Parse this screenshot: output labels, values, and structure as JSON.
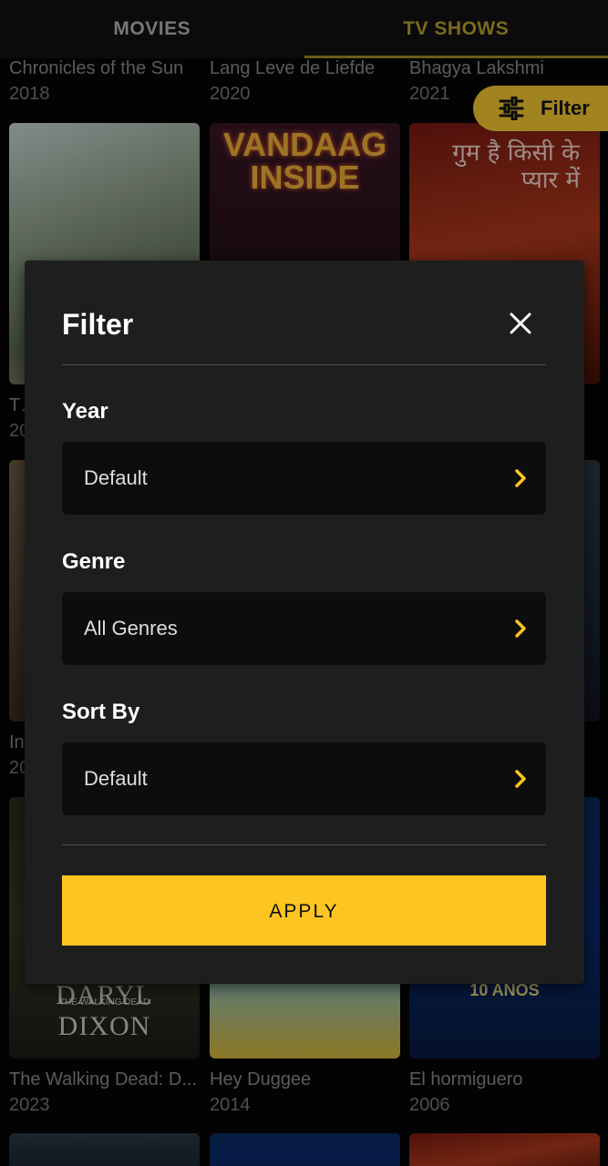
{
  "tabs": [
    {
      "label": "MOVIES"
    },
    {
      "label": "TV SHOWS"
    }
  ],
  "filter_button": {
    "label": "Filter",
    "icon": "sliders-icon"
  },
  "grid": {
    "top_row": [
      {
        "title": "Chronicles of the Sun",
        "year": "2018"
      },
      {
        "title": "Lang Leve de Liefde",
        "year": "2020"
      },
      {
        "title": "Bhagya Lakshmi",
        "year": "2021"
      }
    ],
    "row1_posters": {
      "poster2_text": "VANDAAG INSIDE",
      "poster3_text": "गुम है किसी के प्यार में"
    },
    "row1_captions": [
      {
        "title": "Th",
        "year": "20"
      }
    ],
    "row2_captions": [
      {
        "title": "In",
        "year": "20"
      }
    ],
    "row3_posters": {
      "poster1_small": "THE WALKING DEAD",
      "poster1_text": "DARYL DIXON",
      "poster3_text": "10 AÑOS"
    },
    "row3": [
      {
        "title": "The Walking Dead: D...",
        "year": "2023"
      },
      {
        "title": "Hey Duggee",
        "year": "2014"
      },
      {
        "title": "El hormiguero",
        "year": "2006"
      }
    ]
  },
  "dialog": {
    "title": "Filter",
    "close_icon": "close-icon",
    "fields": [
      {
        "label": "Year",
        "value": "Default"
      },
      {
        "label": "Genre",
        "value": "All Genres"
      },
      {
        "label": "Sort By",
        "value": "Default"
      }
    ],
    "apply_label": "APPLY"
  },
  "colors": {
    "accent": "#fcc521",
    "dialog_bg": "#1e1e1f",
    "select_bg": "#0d0d0e"
  }
}
